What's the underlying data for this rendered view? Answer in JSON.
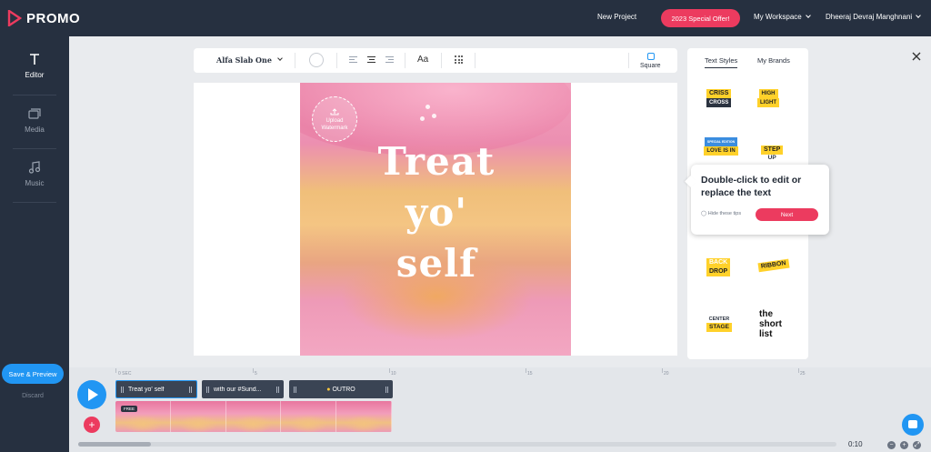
{
  "app": {
    "brand": "PROMO"
  },
  "topnav": {
    "new_project": "New Project",
    "offer": "2023 Special Offer!",
    "workspace": "My Workspace",
    "user": "Dheeraj Devraj Manghnani"
  },
  "sidebar": {
    "items": [
      {
        "label": "Editor",
        "icon": "text-t-icon",
        "active": true
      },
      {
        "label": "Media",
        "icon": "media-icon",
        "active": false
      },
      {
        "label": "Music",
        "icon": "music-note-icon",
        "active": false
      }
    ],
    "save_label": "Save & Preview",
    "discard_label": "Discard"
  },
  "toolbar": {
    "font": "Alfa Slab One",
    "case_label": "Aa",
    "square_label": "Square"
  },
  "canvas": {
    "watermark_label": "Upload Watermark",
    "headline": [
      "Treat",
      "yo'",
      "self"
    ]
  },
  "right_panel": {
    "tabs": [
      "Text Styles",
      "My Brands"
    ],
    "styles": [
      {
        "top": "CRISS",
        "bottom": "CROSS"
      },
      {
        "top": "HIGH",
        "bottom": "LIGHT"
      },
      {
        "top": "LOVE IS IN",
        "bottom": "SPECIAL EDITION"
      },
      {
        "top": "STEP",
        "bottom": "UP"
      },
      {
        "top": "BACK",
        "bottom": "DROP"
      },
      {
        "top": "RIBBON",
        "bottom": ""
      },
      {
        "top": "CENTER",
        "bottom": "STAGE"
      },
      {
        "top": "the short",
        "bottom": "list"
      }
    ]
  },
  "tooltip": {
    "text": "Double-click to edit or replace the text",
    "hide_label": "Hide these tips",
    "next_label": "Next"
  },
  "timeline": {
    "ruler": [
      "0 SEC",
      "5",
      "10",
      "15",
      "20",
      "25"
    ],
    "clips": [
      "Treat yo' self",
      "with our #Sund...",
      "OUTRO"
    ],
    "free_badge": "FREE",
    "time": "0:10"
  },
  "colors": {
    "accent": "#2196f3",
    "brand": "#ec3b5f",
    "dark": "#263040"
  }
}
